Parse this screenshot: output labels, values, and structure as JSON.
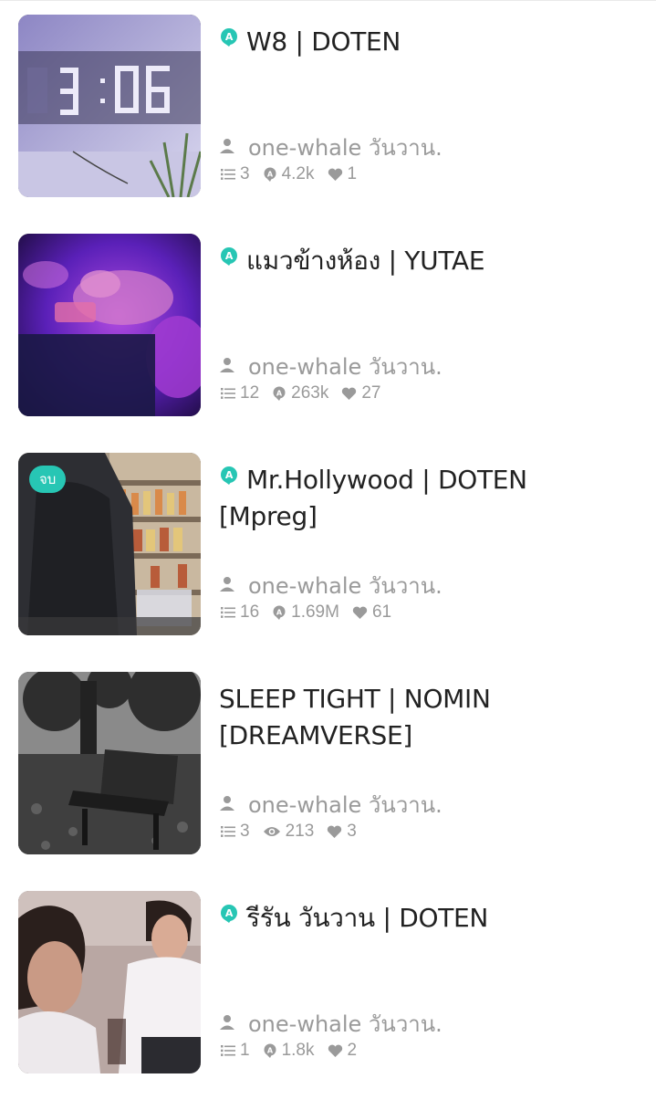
{
  "stories": [
    {
      "title": "W8 | DOTEN",
      "title_icon": "joylada-badge-icon",
      "author": "one-whale วันวาน.",
      "chapters": "3",
      "reads_icon": "joylada-badge-icon",
      "reads": "4.2k",
      "likes": "1",
      "end_badge": ""
    },
    {
      "title": "แมวข้างห้อง | YUTAE",
      "title_icon": "joylada-badge-icon",
      "author": "one-whale วันวาน.",
      "chapters": "12",
      "reads_icon": "joylada-badge-icon",
      "reads": "263k",
      "likes": "27",
      "end_badge": ""
    },
    {
      "title_line1": "Mr.Hollywood | DOTEN",
      "title_line2": "[Mpreg]",
      "title_icon": "joylada-badge-icon",
      "author": "one-whale วันวาน.",
      "chapters": "16",
      "reads_icon": "joylada-badge-icon",
      "reads": "1.69M",
      "likes": "61",
      "end_badge": "จบ"
    },
    {
      "title_line1": "SLEEP TIGHT | NOMIN",
      "title_line2": "[DREAMVERSE]",
      "author": "one-whale วันวาน.",
      "chapters": "3",
      "reads_icon": "eye-icon",
      "reads": "213",
      "likes": "3",
      "end_badge": ""
    },
    {
      "title": "รีรัน วันวาน | DOTEN",
      "title_icon": "joylada-badge-icon",
      "author": "one-whale วันวาน.",
      "chapters": "1",
      "reads_icon": "joylada-badge-icon",
      "reads": "1.8k",
      "likes": "2",
      "end_badge": ""
    }
  ],
  "colors": {
    "accent": "#27c6b4",
    "title_text": "#222222",
    "meta_text": "#9a9a9a"
  }
}
